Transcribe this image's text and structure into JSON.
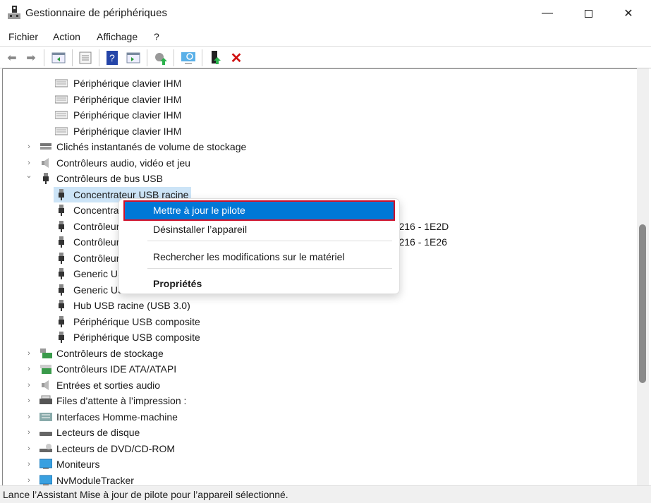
{
  "window": {
    "title": "Gestionnaire de périphériques",
    "minimize_icon": "minimize-icon",
    "maximize_icon": "maximize-icon",
    "close_icon": "close-icon"
  },
  "menu": [
    "Fichier",
    "Action",
    "Affichage",
    "?"
  ],
  "toolbar": [
    "back-icon",
    "forward-icon",
    "show-hide-console-tree-icon",
    "properties-icon",
    "help-icon",
    "show-action-pane-icon",
    "update-driver-icon",
    "scan-hardware-icon",
    "enable-device-icon",
    "uninstall-icon"
  ],
  "tree": [
    {
      "level": 1,
      "label": "Périphérique clavier IHM",
      "icon": "keyboard-icon"
    },
    {
      "level": 1,
      "label": "Périphérique clavier IHM",
      "icon": "keyboard-icon"
    },
    {
      "level": 1,
      "label": "Périphérique clavier IHM",
      "icon": "keyboard-icon"
    },
    {
      "level": 1,
      "label": "Périphérique clavier IHM",
      "icon": "keyboard-icon"
    },
    {
      "level": 0,
      "label": "Clichés instantanés de volume de stockage",
      "icon": "storage-icon",
      "expanded": false
    },
    {
      "level": 0,
      "label": "Contrôleurs audio, vidéo et jeu",
      "icon": "speaker-icon",
      "expanded": false
    },
    {
      "level": 0,
      "label": "Contrôleurs de bus USB",
      "icon": "usb-icon",
      "expanded": true
    },
    {
      "level": 1,
      "label": "Concentrateur USB racine",
      "icon": "usb-icon",
      "selected": true
    },
    {
      "level": 1,
      "label": "Concentrateur USB racine",
      "icon": "usb-icon"
    },
    {
      "level": 1,
      "label": "Contrôleur d’hôte USB amélioré de la famille de jeux de puces Intel(R) 7/C216 - 1E2D",
      "icon": "usb-icon"
    },
    {
      "level": 1,
      "label": "Contrôleur d’hôte USB amélioré de la famille de jeux de puces Intel(R) 7/C216 - 1E26",
      "icon": "usb-icon"
    },
    {
      "level": 1,
      "label": "Contrôleur USB",
      "icon": "usb-icon"
    },
    {
      "level": 1,
      "label": "Generic USB Hub",
      "icon": "usb-icon"
    },
    {
      "level": 1,
      "label": "Generic USB Hub",
      "icon": "usb-icon"
    },
    {
      "level": 1,
      "label": "Hub USB racine (USB 3.0)",
      "icon": "usb-icon"
    },
    {
      "level": 1,
      "label": "Périphérique USB composite",
      "icon": "usb-icon"
    },
    {
      "level": 1,
      "label": "Périphérique USB composite",
      "icon": "usb-icon"
    },
    {
      "level": 0,
      "label": "Contrôleurs de stockage",
      "icon": "storage-controller-icon",
      "expanded": false
    },
    {
      "level": 0,
      "label": "Contrôleurs IDE ATA/ATAPI",
      "icon": "ide-icon",
      "expanded": false
    },
    {
      "level": 0,
      "label": "Entrées et sorties audio",
      "icon": "speaker-icon",
      "expanded": false
    },
    {
      "level": 0,
      "label": "Files d’attente à l’impression :",
      "icon": "printer-icon",
      "expanded": false
    },
    {
      "level": 0,
      "label": "Interfaces Homme-machine",
      "icon": "hid-icon",
      "expanded": false
    },
    {
      "level": 0,
      "label": "Lecteurs de disque",
      "icon": "disk-icon",
      "expanded": false
    },
    {
      "level": 0,
      "label": "Lecteurs de DVD/CD-ROM",
      "icon": "dvd-icon",
      "expanded": false
    },
    {
      "level": 0,
      "label": "Moniteurs",
      "icon": "monitor-icon",
      "expanded": false
    },
    {
      "level": 0,
      "label": "NvModuleTracker",
      "icon": "monitor-icon",
      "expanded": false
    }
  ],
  "context_menu": {
    "items": [
      "Mettre à jour le pilote",
      "Désinstaller l’appareil",
      "Rechercher les modifications sur le matériel",
      "Propriétés"
    ],
    "highlighted": "Mettre à jour le pilote"
  },
  "status": "Lance l’Assistant Mise à jour de pilote pour l’appareil sélectionné.",
  "colors": {
    "highlight": "#0078d7",
    "selection": "#cce4f7",
    "outline": "#d0102a"
  }
}
